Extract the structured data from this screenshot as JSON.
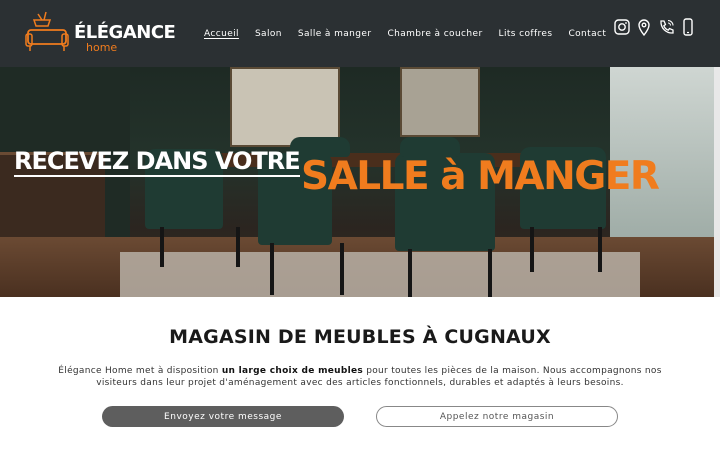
{
  "header": {
    "logo": {
      "brand": "ÉLÉGANCE",
      "sub": "home"
    },
    "nav": [
      {
        "label": "Accueil",
        "active": true
      },
      {
        "label": "Salon",
        "active": false
      },
      {
        "label": "Salle à manger",
        "active": false
      },
      {
        "label": "Chambre à coucher",
        "active": false
      },
      {
        "label": "Lits coffres",
        "active": false
      },
      {
        "label": "Contact",
        "active": false
      }
    ],
    "icons": [
      "instagram-icon",
      "map-pin-icon",
      "phone-icon",
      "mobile-phone-icon"
    ]
  },
  "hero": {
    "line1": "RECEVEZ DANS VOTRE",
    "line2": "SALLE à MANGER"
  },
  "main": {
    "title": "MAGASIN DE MEUBLES À CUGNAUX",
    "text_before": "Élégance Home met à disposition ",
    "text_bold": "un large choix de meubles",
    "text_after": " pour toutes les pièces de la maison. Nous accompagnons nos visiteurs dans leur projet d'aménagement avec des articles fonctionnels, durables et adaptés à leurs besoins.",
    "button_message": "Envoyez votre message",
    "button_call": "Appelez notre magasin"
  },
  "colors": {
    "accent": "#f07c1e",
    "header_bg": "#2b3033",
    "button_dark": "#5e5e5e"
  }
}
